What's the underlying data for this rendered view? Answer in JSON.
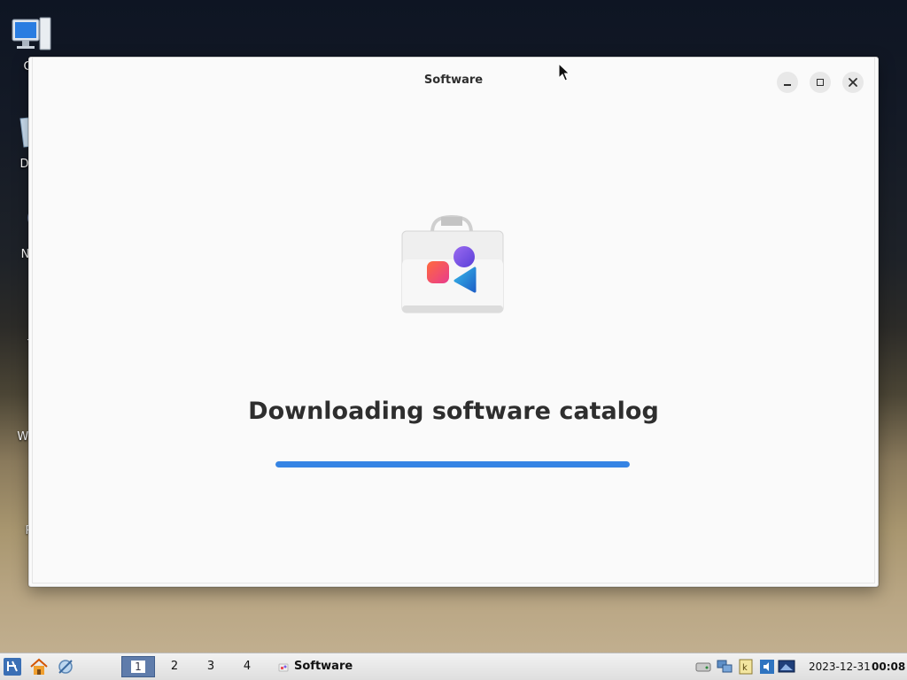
{
  "desktop": {
    "icons": [
      {
        "label": "Co",
        "icon": "computer-icon"
      },
      {
        "label": "Doc",
        "icon": "documents-icon"
      },
      {
        "label": "Net",
        "icon": "network-icon"
      },
      {
        "label": "T",
        "icon": "trash-icon"
      },
      {
        "label": "W Br",
        "icon": "web-browser-icon"
      },
      {
        "label": "Pr",
        "icon": "printer-icon"
      }
    ]
  },
  "window": {
    "title": "Software",
    "minimize_label": "minimize",
    "maximize_label": "maximize",
    "close_label": "close",
    "heading": "Downloading software catalog",
    "progress_fraction": 1.0,
    "accent_color": "#3584e4"
  },
  "taskbar": {
    "workspaces": [
      "1",
      "2",
      "3",
      "4"
    ],
    "active_workspace": "1",
    "task_label": "Software",
    "date": "2023-12-31",
    "time": "00:08"
  }
}
